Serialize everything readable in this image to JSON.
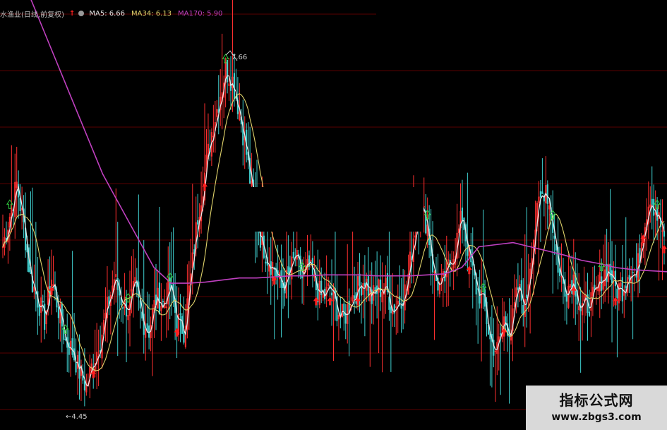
{
  "legend": {
    "stock_name": "水渔业(日线,前复权)",
    "ma5": "MA5: 6.66",
    "ma34": "MA34: 6.13",
    "ma170": "MA170: 5.90"
  },
  "labels": {
    "peak": "7.66",
    "low": "4.45"
  },
  "watermark": {
    "title": "指标公式网",
    "url": "www.zbgs3.com"
  },
  "colors": {
    "up": "#ff3030",
    "down": "#40d0d0",
    "ma5": "#e6e6e6",
    "ma34": "#e0d36b",
    "ma170": "#c040c0",
    "grid": "#5a0000",
    "buy": "#ff2020",
    "sell": "#30d040"
  },
  "chart_data": {
    "type": "candlestick",
    "ylim": [
      4.2,
      8.0
    ],
    "peak_value": 7.66,
    "low_value": 4.45,
    "price_path": [
      5.9,
      6.2,
      6.5,
      6.1,
      5.6,
      5.4,
      5.2,
      5.6,
      5.3,
      5.0,
      4.9,
      4.7,
      4.55,
      4.8,
      5.0,
      5.3,
      5.6,
      5.4,
      5.3,
      5.5,
      5.2,
      5.1,
      5.4,
      5.35,
      5.5,
      5.2,
      5.1,
      5.6,
      6.2,
      6.6,
      7.0,
      7.3,
      7.6,
      7.5,
      7.2,
      6.8,
      6.3,
      6.0,
      5.8,
      5.7,
      5.5,
      5.6,
      5.8,
      5.6,
      5.7,
      5.5,
      5.4,
      5.5,
      5.3,
      5.2,
      5.4,
      5.5,
      5.6,
      5.4,
      5.5,
      5.5,
      5.3,
      5.4,
      5.5,
      6.0,
      6.3,
      6.1,
      5.6,
      5.5,
      5.7,
      5.9,
      6.2,
      5.8,
      5.5,
      5.4,
      5.0,
      4.9,
      5.2,
      5.1,
      5.5,
      5.3,
      5.9,
      6.3,
      6.5,
      6.1,
      5.6,
      5.5,
      5.6,
      5.3,
      5.35,
      5.4,
      5.6,
      5.7,
      5.5,
      5.5,
      5.7,
      5.6,
      6.1,
      6.4,
      6.2,
      6.0
    ],
    "ma170": [
      8.9,
      8.6,
      8.2,
      7.8,
      7.4,
      7.0,
      6.6,
      6.3,
      6.0,
      5.7,
      5.55,
      5.55,
      5.56,
      5.58,
      5.6,
      5.6,
      5.61,
      5.62,
      5.62,
      5.63,
      5.63,
      5.63,
      5.62,
      5.62,
      5.62,
      5.63,
      5.64,
      5.7,
      5.9,
      5.92,
      5.94,
      5.9,
      5.86,
      5.82,
      5.77,
      5.74,
      5.7,
      5.68,
      5.67,
      5.66
    ],
    "signals": [
      {
        "type": "buy",
        "index": 7
      },
      {
        "type": "buy",
        "index": 13
      },
      {
        "type": "buy",
        "index": 25
      },
      {
        "type": "buy",
        "index": 29
      },
      {
        "type": "buy",
        "index": 39
      },
      {
        "type": "buy",
        "index": 45
      },
      {
        "type": "buy",
        "index": 47
      },
      {
        "type": "buy",
        "index": 51
      },
      {
        "type": "buy",
        "index": 67
      },
      {
        "type": "buy",
        "index": 72
      },
      {
        "type": "buy",
        "index": 82
      },
      {
        "type": "buy",
        "index": 88
      },
      {
        "type": "buy",
        "index": 92
      },
      {
        "type": "buy",
        "index": 95
      },
      {
        "type": "sell",
        "index": 1
      },
      {
        "type": "sell",
        "index": 9
      },
      {
        "type": "sell",
        "index": 18
      },
      {
        "type": "sell",
        "index": 24
      },
      {
        "type": "sell",
        "index": 32
      },
      {
        "type": "sell",
        "index": 36
      },
      {
        "type": "sell",
        "index": 43
      },
      {
        "type": "sell",
        "index": 61
      },
      {
        "type": "sell",
        "index": 69
      },
      {
        "type": "sell",
        "index": 79
      },
      {
        "type": "sell",
        "index": 86
      },
      {
        "type": "sell",
        "index": 94
      }
    ]
  }
}
